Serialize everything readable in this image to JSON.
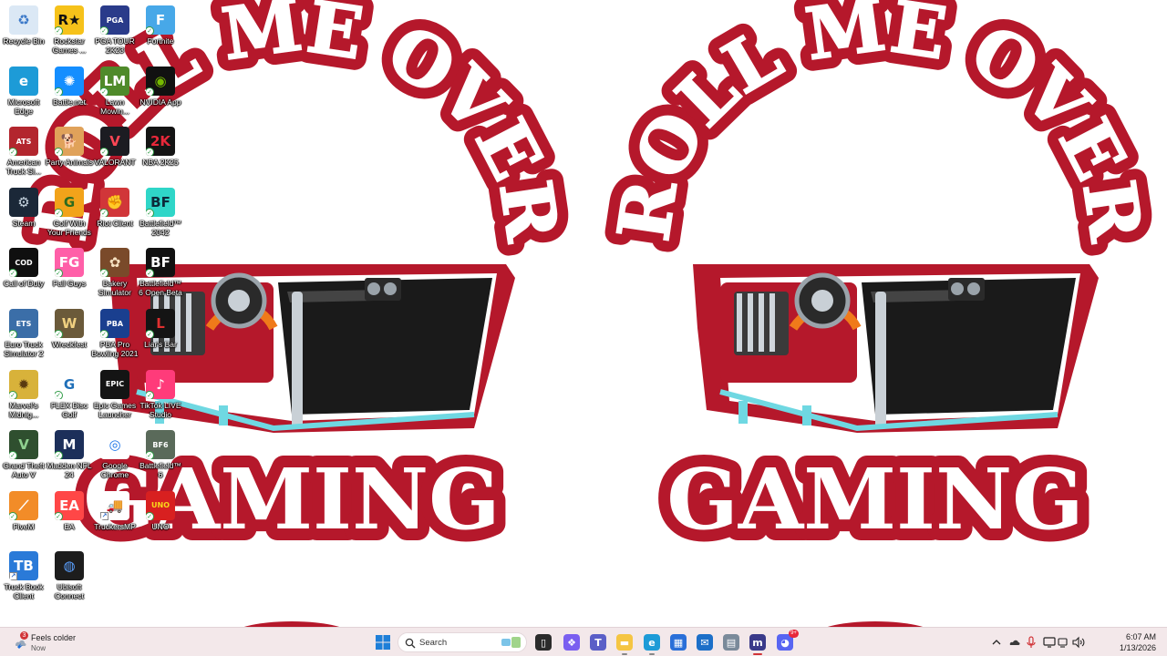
{
  "wallpaper": {
    "arc_text": "ROLL ME OVER",
    "bottom_text": "GAMING",
    "colors": {
      "red": "#b5182b",
      "white": "#ffffff",
      "black": "#1a1a1a",
      "cyan": "#6fd8e2",
      "orange": "#f07a1a"
    }
  },
  "desktop_icons": [
    {
      "label": "Recycle Bin",
      "icon": "recycle-bin-icon",
      "color": "#dbe8f5",
      "glyph": "♻",
      "glyph_color": "#3a78c8",
      "badge": "none"
    },
    {
      "label": "Rockstar Games ...",
      "icon": "rockstar-games-icon",
      "color": "#f6c21a",
      "glyph": "R★",
      "glyph_color": "#111111",
      "badge": "check"
    },
    {
      "label": "PGA TOUR 2K23",
      "icon": "pga-tour-icon",
      "color": "#2a3b8a",
      "glyph": "PGA",
      "glyph_color": "#ffffff",
      "badge": "check"
    },
    {
      "label": "Fortnite",
      "icon": "fortnite-icon",
      "color": "#47a8e8",
      "glyph": "F",
      "glyph_color": "#ffffff",
      "badge": "check"
    },
    {
      "label": "Microsoft Edge",
      "icon": "edge-icon",
      "color": "#1d9bd7",
      "glyph": "e",
      "glyph_color": "#ffffff",
      "badge": "none"
    },
    {
      "label": "Battle.net",
      "icon": "battlenet-icon",
      "color": "#148eff",
      "glyph": "✺",
      "glyph_color": "#ffffff",
      "badge": "check"
    },
    {
      "label": "Lawn Mowin...",
      "icon": "lawn-mowing-icon",
      "color": "#4f8a2a",
      "glyph": "LM",
      "glyph_color": "#ffffff",
      "badge": "check"
    },
    {
      "label": "NVIDIA App",
      "icon": "nvidia-icon",
      "color": "#111111",
      "glyph": "◉",
      "glyph_color": "#76b900",
      "badge": "check"
    },
    {
      "label": "American Truck Si...",
      "icon": "american-truck-icon",
      "color": "#b3262e",
      "glyph": "ATS",
      "glyph_color": "#ffffff",
      "badge": "check"
    },
    {
      "label": "Party Animals",
      "icon": "party-animals-icon",
      "color": "#e0a25a",
      "glyph": "🐕",
      "glyph_color": "#ffffff",
      "badge": "check"
    },
    {
      "label": "VALORANT",
      "icon": "valorant-icon",
      "color": "#1c1c22",
      "glyph": "V",
      "glyph_color": "#ff4655",
      "badge": "check"
    },
    {
      "label": "NBA 2K25",
      "icon": "nba-2k25-icon",
      "color": "#141414",
      "glyph": "2K",
      "glyph_color": "#e8283a",
      "badge": "check"
    },
    {
      "label": "Steam",
      "icon": "steam-icon",
      "color": "#1b2838",
      "glyph": "⚙",
      "glyph_color": "#c7d5e0",
      "badge": "none"
    },
    {
      "label": "Golf With Your Friends",
      "icon": "golf-with-friends-icon",
      "color": "#f2a31a",
      "glyph": "G",
      "glyph_color": "#2d6b1f",
      "badge": "check"
    },
    {
      "label": "Riot Client",
      "icon": "riot-client-icon",
      "color": "#d13639",
      "glyph": "✊",
      "glyph_color": "#ffffff",
      "badge": "check"
    },
    {
      "label": "Battlefield™ 2042",
      "icon": "battlefield-2042-icon",
      "color": "#2fd6c8",
      "glyph": "BF",
      "glyph_color": "#0d2a3a",
      "badge": "check"
    },
    {
      "label": "Call of Duty",
      "icon": "call-of-duty-icon",
      "color": "#0f0f0f",
      "glyph": "COD",
      "glyph_color": "#ffffff",
      "badge": "check"
    },
    {
      "label": "Fall Guys",
      "icon": "fall-guys-icon",
      "color": "#ff5fa8",
      "glyph": "FG",
      "glyph_color": "#ffffff",
      "badge": "check"
    },
    {
      "label": "Bakery Simulator",
      "icon": "bakery-simulator-icon",
      "color": "#7a4a2a",
      "glyph": "✿",
      "glyph_color": "#f5e0c0",
      "badge": "check"
    },
    {
      "label": "Battlefield™ 6 Open Beta",
      "icon": "battlefield-6-beta-icon",
      "color": "#111111",
      "glyph": "BF",
      "glyph_color": "#ffffff",
      "badge": "check"
    },
    {
      "label": "Euro Truck Simulator 2",
      "icon": "euro-truck-icon",
      "color": "#3b6ea8",
      "glyph": "ETS",
      "glyph_color": "#ffffff",
      "badge": "check"
    },
    {
      "label": "Wreckfest",
      "icon": "wreckfest-icon",
      "color": "#6b5a3a",
      "glyph": "W",
      "glyph_color": "#f0d080",
      "badge": "check"
    },
    {
      "label": "PBA Pro Bowling 2021",
      "icon": "pba-bowling-icon",
      "color": "#1a3f8f",
      "glyph": "PBA",
      "glyph_color": "#ffffff",
      "badge": "check"
    },
    {
      "label": "Liar's Bar",
      "icon": "liars-bar-icon",
      "color": "#141414",
      "glyph": "L",
      "glyph_color": "#e03030",
      "badge": "check"
    },
    {
      "label": "Marvel's Midnig...",
      "icon": "marvels-midnight-icon",
      "color": "#d8b23a",
      "glyph": "✹",
      "glyph_color": "#5a3a10",
      "badge": "check"
    },
    {
      "label": "FLEX Disc Golf",
      "icon": "flex-disc-golf-icon",
      "color": "#ffffff",
      "glyph": "G",
      "glyph_color": "#1f6fb8",
      "badge": "check"
    },
    {
      "label": "Epic Games Launcher",
      "icon": "epic-games-icon",
      "color": "#141414",
      "glyph": "EPIC",
      "glyph_color": "#ffffff",
      "badge": "none"
    },
    {
      "label": "TikTok LIVE Studio",
      "icon": "tiktok-live-icon",
      "color": "#ff3b7a",
      "glyph": "♪",
      "glyph_color": "#ffffff",
      "badge": "check"
    },
    {
      "label": "Grand Theft Auto V",
      "icon": "gta-v-icon",
      "color": "#2f4f2f",
      "glyph": "V",
      "glyph_color": "#8fd18f",
      "badge": "check"
    },
    {
      "label": "Madden NFL 24",
      "icon": "madden-icon",
      "color": "#1c2f5a",
      "glyph": "M",
      "glyph_color": "#ffffff",
      "badge": "check"
    },
    {
      "label": "Google Chrome",
      "icon": "chrome-icon",
      "color": "#ffffff",
      "glyph": "◎",
      "glyph_color": "#1a73e8",
      "badge": "none"
    },
    {
      "label": "Battlefield™ 6",
      "icon": "battlefield-6-icon",
      "color": "#5a6a5a",
      "glyph": "BF6",
      "glyph_color": "#ffffff",
      "badge": "check"
    },
    {
      "label": "FiveM",
      "icon": "fivem-icon",
      "color": "#f28c28",
      "glyph": "⟋",
      "glyph_color": "#ffffff",
      "badge": "check"
    },
    {
      "label": "EA",
      "icon": "ea-icon",
      "color": "#ff4747",
      "glyph": "EA",
      "glyph_color": "#ffffff",
      "badge": "check"
    },
    {
      "label": "TruckersMP",
      "icon": "truckersmp-icon",
      "color": "#ffffff",
      "glyph": "🚚",
      "glyph_color": "#333333",
      "badge": "arrow"
    },
    {
      "label": "UNO",
      "icon": "uno-icon",
      "color": "#d82020",
      "glyph": "UNO",
      "glyph_color": "#f8d81a",
      "badge": "check"
    },
    {
      "label": "Truck Book Client",
      "icon": "truckbook-icon",
      "color": "#2a7ad8",
      "glyph": "TB",
      "glyph_color": "#ffffff",
      "badge": "arrow"
    },
    {
      "label": "Ubisoft Connect",
      "icon": "ubisoft-connect-icon",
      "color": "#1d1d1d",
      "glyph": "◍",
      "glyph_color": "#5aa0ff",
      "badge": "none"
    }
  ],
  "taskbar": {
    "weather": {
      "title": "Feels colder",
      "subtitle": "Now",
      "badge": "3"
    },
    "search_placeholder": "Search",
    "pinned": [
      {
        "name": "task-view-icon",
        "color": "#2b2b2b",
        "glyph": "▯"
      },
      {
        "name": "copilot-icon",
        "color": "#7a5ff0",
        "glyph": "❖"
      },
      {
        "name": "teams-icon",
        "color": "#5b5fc7",
        "glyph": "T"
      },
      {
        "name": "file-explorer-icon",
        "color": "#f5c542",
        "glyph": "▬"
      },
      {
        "name": "edge-taskbar-icon",
        "color": "#1d9bd7",
        "glyph": "e"
      },
      {
        "name": "microsoft-store-icon",
        "color": "#2a6fd8",
        "glyph": "▦"
      },
      {
        "name": "mail-icon",
        "color": "#1c6fc8",
        "glyph": "✉"
      },
      {
        "name": "app-taskbar-icon",
        "color": "#7a8a9a",
        "glyph": "▤"
      },
      {
        "name": "msi-icon",
        "color": "#3a3a8a",
        "glyph": "m"
      },
      {
        "name": "discord-icon",
        "color": "#5865f2",
        "glyph": "◕"
      }
    ],
    "discord_badge": "9+",
    "time": "6:07 AM",
    "date": "1/13/2026"
  }
}
